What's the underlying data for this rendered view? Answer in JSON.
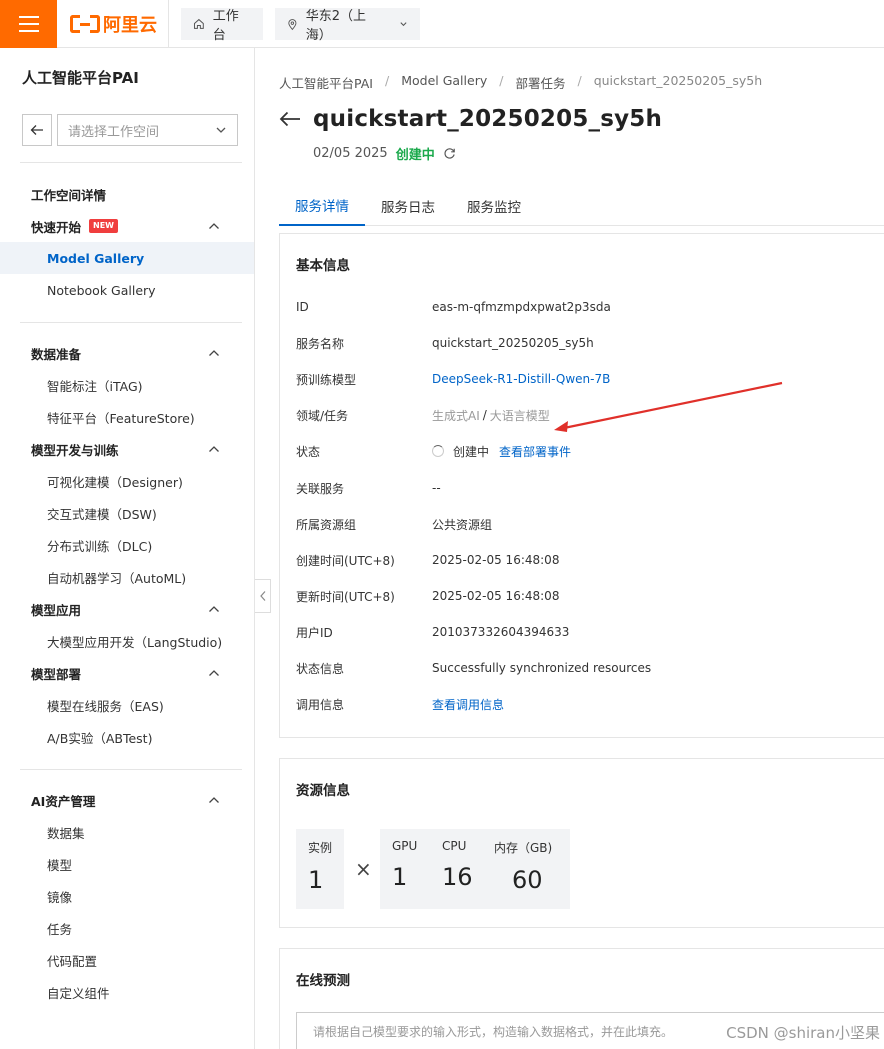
{
  "topbar": {
    "menu_icon": "hamburger-icon",
    "logo_text": "阿里云",
    "workbench_label": "工作台",
    "region_label": "华东2（上海）"
  },
  "sidebar": {
    "title": "人工智能平台PAI",
    "workspace_placeholder": "请选择工作空间",
    "workspace_details": "工作空间详情",
    "groups": [
      {
        "label": "快速开始",
        "badge": "NEW",
        "items": [
          "Model Gallery",
          "Notebook Gallery"
        ]
      },
      {
        "label": "数据准备",
        "items": [
          "智能标注（iTAG)",
          "特征平台（FeatureStore)"
        ]
      },
      {
        "label": "模型开发与训练",
        "items": [
          "可视化建模（Designer)",
          "交互式建模（DSW)",
          "分布式训练（DLC)",
          "自动机器学习（AutoML)"
        ]
      },
      {
        "label": "模型应用",
        "items": [
          "大模型应用开发（LangStudio)"
        ]
      },
      {
        "label": "模型部署",
        "items": [
          "模型在线服务（EAS)",
          "A/B实验（ABTest)"
        ]
      },
      {
        "label": "AI资产管理",
        "items": [
          "数据集",
          "模型",
          "镜像",
          "任务",
          "代码配置",
          "自定义组件"
        ]
      }
    ],
    "active_item": "Model Gallery"
  },
  "breadcrumb": [
    "人工智能平台PAI",
    "Model Gallery",
    "部署任务",
    "quickstart_20250205_sy5h"
  ],
  "page": {
    "title": "quickstart_20250205_sy5h",
    "date": "02/05 2025",
    "status": "创建中"
  },
  "tabs": [
    "服务详情",
    "服务日志",
    "服务监控"
  ],
  "basic": {
    "title": "基本信息",
    "rows": [
      {
        "label": "ID",
        "value": "eas-m-qfmzmpdxpwat2p3sda"
      },
      {
        "label": "服务名称",
        "value": "quickstart_20250205_sy5h"
      },
      {
        "label": "预训练模型",
        "value": "DeepSeek-R1-Distill-Qwen-7B"
      },
      {
        "label": "领域/任务",
        "value_a": "生成式AI",
        "value_sep": "/",
        "value_b": "大语言模型"
      },
      {
        "label": "状态",
        "value": "创建中",
        "link": "查看部署事件"
      },
      {
        "label": "关联服务",
        "value": "--"
      },
      {
        "label": "所属资源组",
        "value": "公共资源组"
      },
      {
        "label": "创建时间(UTC+8)",
        "value": "2025-02-05 16:48:08"
      },
      {
        "label": "更新时间(UTC+8)",
        "value": "2025-02-05 16:48:08"
      },
      {
        "label": "用户ID",
        "value": "201037332604394633"
      },
      {
        "label": "状态信息",
        "value": "Successfully synchronized resources"
      },
      {
        "label": "调用信息",
        "link": "查看调用信息"
      }
    ]
  },
  "resources": {
    "title": "资源信息",
    "instances_label": "实例",
    "instances_value": "1",
    "times": "×",
    "gpu_label": "GPU",
    "gpu_value": "1",
    "cpu_label": "CPU",
    "cpu_value": "16",
    "mem_label": "内存（GB)",
    "mem_value": "60"
  },
  "prediction": {
    "title": "在线预测",
    "placeholder": "请根据自己模型要求的输入形式，构造输入数据格式，并在此填充。"
  },
  "watermark": "CSDN @shiran小坚果",
  "colors": {
    "brand": "#ff6a00",
    "link": "#0064c8",
    "status_green": "#1ba94c",
    "annotation": "#e0302a"
  }
}
